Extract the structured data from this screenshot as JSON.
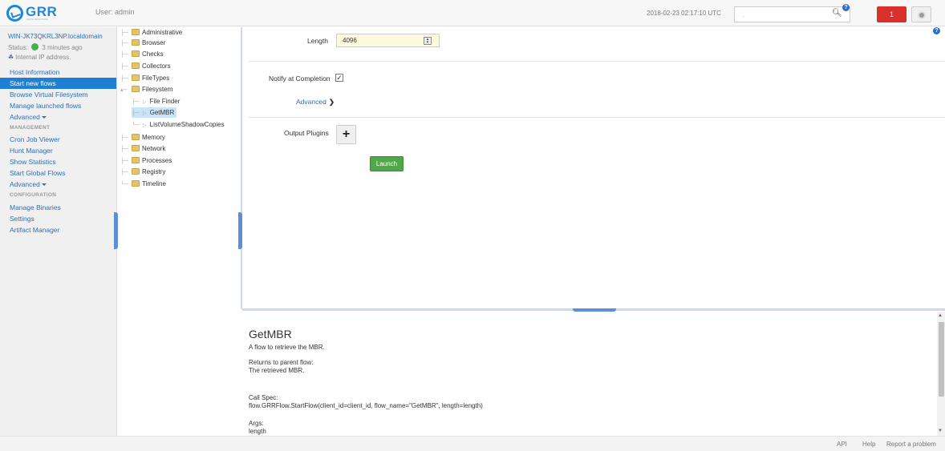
{
  "header": {
    "logo_word": "GRR",
    "logo_sub": "RAPID RESPONSE",
    "user_label": "User: admin",
    "datetime": "2018-02-23 02:17:10 UTC",
    "search_value": ".",
    "notification_count": "1"
  },
  "client": {
    "name": "WIN-JK73QKRL3NP.localdomain",
    "status_prefix": "Status:",
    "status_value": "3 minutes ago",
    "ip": "Internal IP address."
  },
  "nav": {
    "host_information": "Host Information",
    "start_new_flows": "Start new flows",
    "browse_vfs": "Browse Virtual Filesystem",
    "manage_launched": "Manage launched flows",
    "advanced_1": "Advanced",
    "section_management": "MANAGEMENT",
    "cron_job_viewer": "Cron Job Viewer",
    "hunt_manager": "Hunt Manager",
    "show_statistics": "Show Statistics",
    "start_global_flows": "Start Global Flows",
    "advanced_2": "Advanced",
    "section_configuration": "CONFIGURATION",
    "manage_binaries": "Manage Binaries",
    "settings": "Settings",
    "artifact_manager": "Artifact Manager"
  },
  "tree": {
    "administrative": "Administrative",
    "browser": "Browser",
    "checks": "Checks",
    "collectors": "Collectors",
    "filetypes": "FileTypes",
    "filesystem": "Filesystem",
    "file_finder": "File Finder",
    "getmbr": "GetMBR",
    "list_vss": "ListVolumeShadowCopies",
    "memory": "Memory",
    "network": "Network",
    "processes": "Processes",
    "registry": "Registry",
    "timeline": "Timeline"
  },
  "form": {
    "length_label": "Length",
    "length_value": "4096",
    "notify_label": "Notify at Completion",
    "advanced_label": "Advanced",
    "output_plugins_label": "Output Plugins",
    "launch_label": "Launch"
  },
  "description": {
    "title": "GetMBR",
    "summary": "A flow to retrieve the MBR.",
    "returns_label": "Returns to parent flow:",
    "returns_value": "The retrieved MBR.",
    "call_spec_label": "Call Spec:",
    "call_spec_value": "flow.GRRFlow.StartFlow(client_id=client_id, flow_name=\"GetMBR\", length=length)",
    "args_label": "Args:",
    "args_first": "length"
  },
  "footer": {
    "api": "API",
    "help": "Help",
    "report": "Report a problem"
  },
  "colors": {
    "accent": "#1e7fd4",
    "launch": "#4fa949",
    "notification": "#d9302b"
  }
}
